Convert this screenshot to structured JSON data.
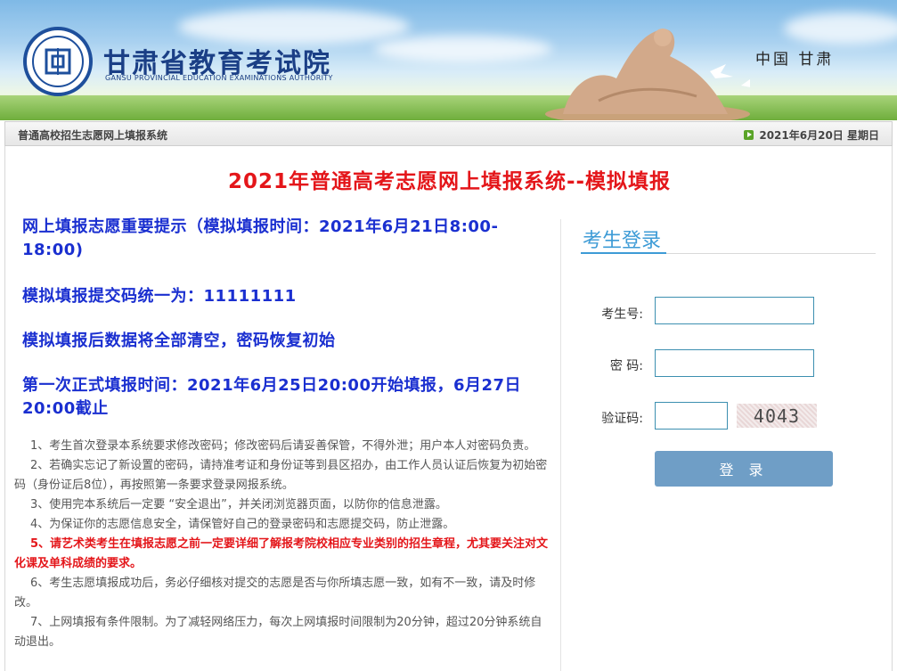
{
  "header": {
    "title": "甘肃省教育考试院",
    "subtitle": "GANSU PROVINCIAL EDUCATION EXAMINATIONS AUTHORITY",
    "region": "中国 甘肃"
  },
  "navbar": {
    "system_name": "普通高校招生志愿网上填报系统",
    "date": "2021年6月20日 星期日"
  },
  "main": {
    "title": "2021年普通高考志愿网上填报系统--模拟填报",
    "notices": [
      "网上填报志愿重要提示（模拟填报时间：2021年6月21日8:00-18:00)",
      "模拟填报提交码统一为：11111111",
      "模拟填报后数据将全部清空，密码恢复初始",
      "第一次正式填报时间：2021年6月25日20:00开始填报，6月27日20:00截止"
    ],
    "rules": [
      "1、考生首次登录本系统要求修改密码；修改密码后请妥善保管，不得外泄；用户本人对密码负责。",
      "2、若确实忘记了新设置的密码，请持准考证和身份证等到县区招办，由工作人员认证后恢复为初始密码（身份证后8位），再按照第一条要求登录网报系统。",
      "3、使用完本系统后一定要 “安全退出”，并关闭浏览器页面，以防你的信息泄露。",
      "4、为保证你的志愿信息安全，请保管好自己的登录密码和志愿提交码，防止泄露。",
      "5、请艺术类考生在填报志愿之前一定要详细了解报考院校相应专业类别的招生章程，尤其要关注对文化课及单科成绩的要求。",
      "6、考生志愿填报成功后，务必仔细核对提交的志愿是否与你所填志愿一致，如有不一致，请及时修改。",
      "7、上网填报有条件限制。为了减轻网络压力，每次上网填报时间限制为20分钟，超过20分钟系统自动退出。"
    ]
  },
  "login": {
    "title": "考生登录",
    "exam_no_label": "考生号:",
    "exam_no_value": "",
    "password_label": "密 码:",
    "password_value": "",
    "captcha_label": "验证码:",
    "captcha_value": "",
    "captcha_image_text": "4043",
    "submit_label": "登 录"
  },
  "colors": {
    "accent_blue": "#3d9bd6",
    "notice_blue": "#1a2fd0",
    "alert_red": "#e4161a",
    "button": "#6f9ec6"
  }
}
